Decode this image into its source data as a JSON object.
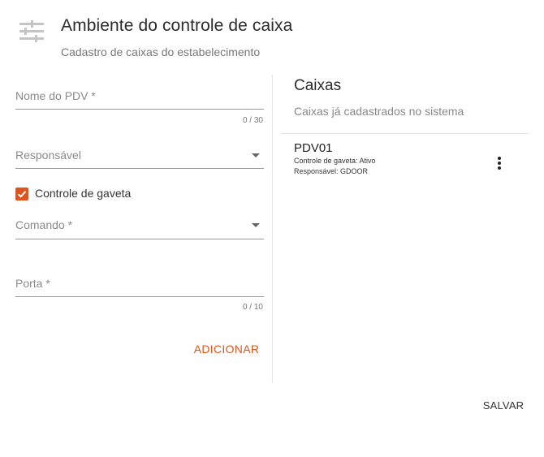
{
  "header": {
    "icon": "tune-sliders-icon",
    "title": "Ambiente do controle de caixa",
    "subtitle": "Cadastro de caixas do estabelecimento"
  },
  "form": {
    "pdv_name": {
      "label": "Nome do PDV *",
      "value": "",
      "counter": "0 / 30"
    },
    "responsavel": {
      "label": "Responsável",
      "value": ""
    },
    "controle_gaveta": {
      "label": "Controle de gaveta",
      "checked": true
    },
    "comando": {
      "label": "Comando *",
      "value": ""
    },
    "porta": {
      "label": "Porta *",
      "value": "",
      "counter": "0 / 10"
    },
    "add_label": "ADICIONAR"
  },
  "caixas": {
    "title": "Caixas",
    "subtitle": "Caixas já cadastrados no sistema",
    "items": [
      {
        "name": "PDV01",
        "gaveta": "Controle de gaveta: Ativo",
        "responsavel": "Responsável: GDOOR"
      }
    ]
  },
  "footer": {
    "save_label": "SALVAR"
  },
  "colors": {
    "accent": "#e0531d",
    "text": "#333333",
    "muted": "#8a8a8a",
    "divider": "#e4e4e4"
  }
}
